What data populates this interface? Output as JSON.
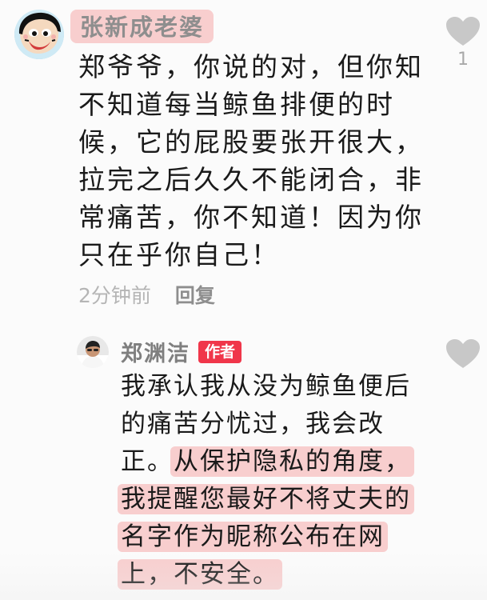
{
  "comment": {
    "username": "张新成老婆",
    "text_lines": [
      "郑爷爷，你说的对，但你知",
      "不知道每当鲸鱼排便的时",
      "候，它的屁股要张开很大，",
      "拉完之后久久不能闭合，非",
      "常痛苦，你不知道！因为你",
      "只在乎你自己！"
    ],
    "time": "2分钟前",
    "reply_label": "回复",
    "like_count": "1",
    "icons": {
      "avatar": "cartoon-avatar-icon",
      "like": "heart-icon"
    }
  },
  "reply": {
    "username": "郑渊洁",
    "author_badge": "作者",
    "text_lines": [
      {
        "plain": "我承认我从没为鲸鱼便后",
        "highlight": ""
      },
      {
        "plain": "的痛苦分忧过，我会改",
        "highlight": ""
      },
      {
        "plain": "正。",
        "highlight": "从保护隐私的角度，"
      },
      {
        "plain": "",
        "highlight": "我提醒您最好不将丈夫的"
      },
      {
        "plain": "",
        "highlight": "名字作为昵称公布在网"
      },
      {
        "plain": "",
        "highlight": "上，不安全。"
      }
    ],
    "icons": {
      "avatar": "person-avatar-icon",
      "like": "heart-icon"
    }
  },
  "colors": {
    "highlight": "#F39696",
    "badge": "#F0364A",
    "heart": "#C8C8C8",
    "muted_text": "#B5B5B5"
  }
}
